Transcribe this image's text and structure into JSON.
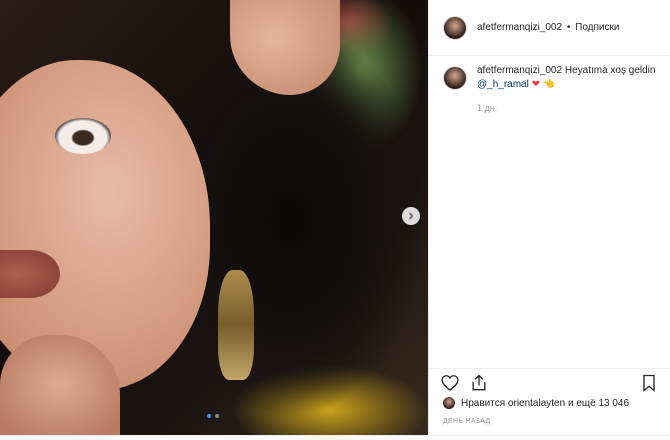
{
  "post": {
    "header": {
      "username": "afetfermanqizi_002",
      "separator": "•",
      "follow_label": "Подписки"
    },
    "caption": {
      "username": "afetfermanqizi_002",
      "text": "Heyatıma xoş geldin",
      "mention": "@_h_ramal",
      "emoji_heart": "❤",
      "emoji_hand": "👈",
      "time": "1 дн."
    },
    "likes": {
      "prefix": "Нравится",
      "liker": "orientalayten",
      "suffix": "и ещё 13 046"
    },
    "date": "ДЕНЬ НАЗАД",
    "carousel": {
      "slides": 2,
      "active": 1
    },
    "icons": {
      "like": "heart-outline-icon",
      "share": "share-icon",
      "save": "bookmark-icon",
      "next": "chevron-right-icon"
    },
    "colors": {
      "accent_blue": "#3897f0",
      "mention": "#003569",
      "heart": "#ed4956",
      "muted": "#999999",
      "border": "#efefef"
    }
  }
}
